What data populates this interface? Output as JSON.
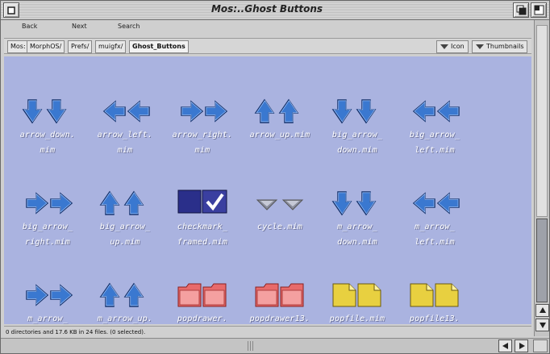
{
  "window": {
    "title": "Mos:..Ghost Buttons",
    "icons": {
      "close": "close-icon",
      "depth": "depth-icon",
      "zoom": "zoom-icon"
    }
  },
  "toolbar": {
    "back": "Back",
    "next": "Next",
    "search": "Search"
  },
  "path": [
    "Mos:",
    "MorphOS/",
    "Prefs/",
    "muigfx/",
    "Ghost_Buttons"
  ],
  "view": {
    "icon": "Icon",
    "thumbnails": "Thumbnails"
  },
  "files": [
    {
      "label": "arrow_down.\nmim",
      "icon": "arrow-down"
    },
    {
      "label": "arrow_left.\nmim",
      "icon": "arrow-left"
    },
    {
      "label": "arrow_right.\nmim",
      "icon": "arrow-right"
    },
    {
      "label": "arrow_up.mim",
      "icon": "arrow-up"
    },
    {
      "label": "big_arrow_\ndown.mim",
      "icon": "arrow-down"
    },
    {
      "label": "big_arrow_\nleft.mim",
      "icon": "arrow-left"
    },
    {
      "label": "big_arrow_\nright.mim",
      "icon": "arrow-right"
    },
    {
      "label": "big_arrow_\nup.mim",
      "icon": "arrow-up"
    },
    {
      "label": "checkmark_\nframed.mim",
      "icon": "checkmark"
    },
    {
      "label": "cycle.mim",
      "icon": "cycle"
    },
    {
      "label": "m_arrow_\ndown.mim",
      "icon": "arrow-down"
    },
    {
      "label": "m_arrow_\nleft.mim",
      "icon": "arrow-left"
    },
    {
      "label": "m_arrow_",
      "icon": "arrow-right"
    },
    {
      "label": "m_arrow_up.",
      "icon": "arrow-up"
    },
    {
      "label": "popdrawer.",
      "icon": "drawer"
    },
    {
      "label": "popdrawer13.",
      "icon": "drawer"
    },
    {
      "label": "popfile.mim",
      "icon": "file"
    },
    {
      "label": "popfile13.",
      "icon": "file"
    }
  ],
  "status": "0 directories and 17.6 KB in 24 files. (0 selected).",
  "colors": {
    "background": "#aab3e0",
    "arrow": "#3a78d0",
    "drawer": "#e86a6a",
    "file": "#e8d040"
  }
}
